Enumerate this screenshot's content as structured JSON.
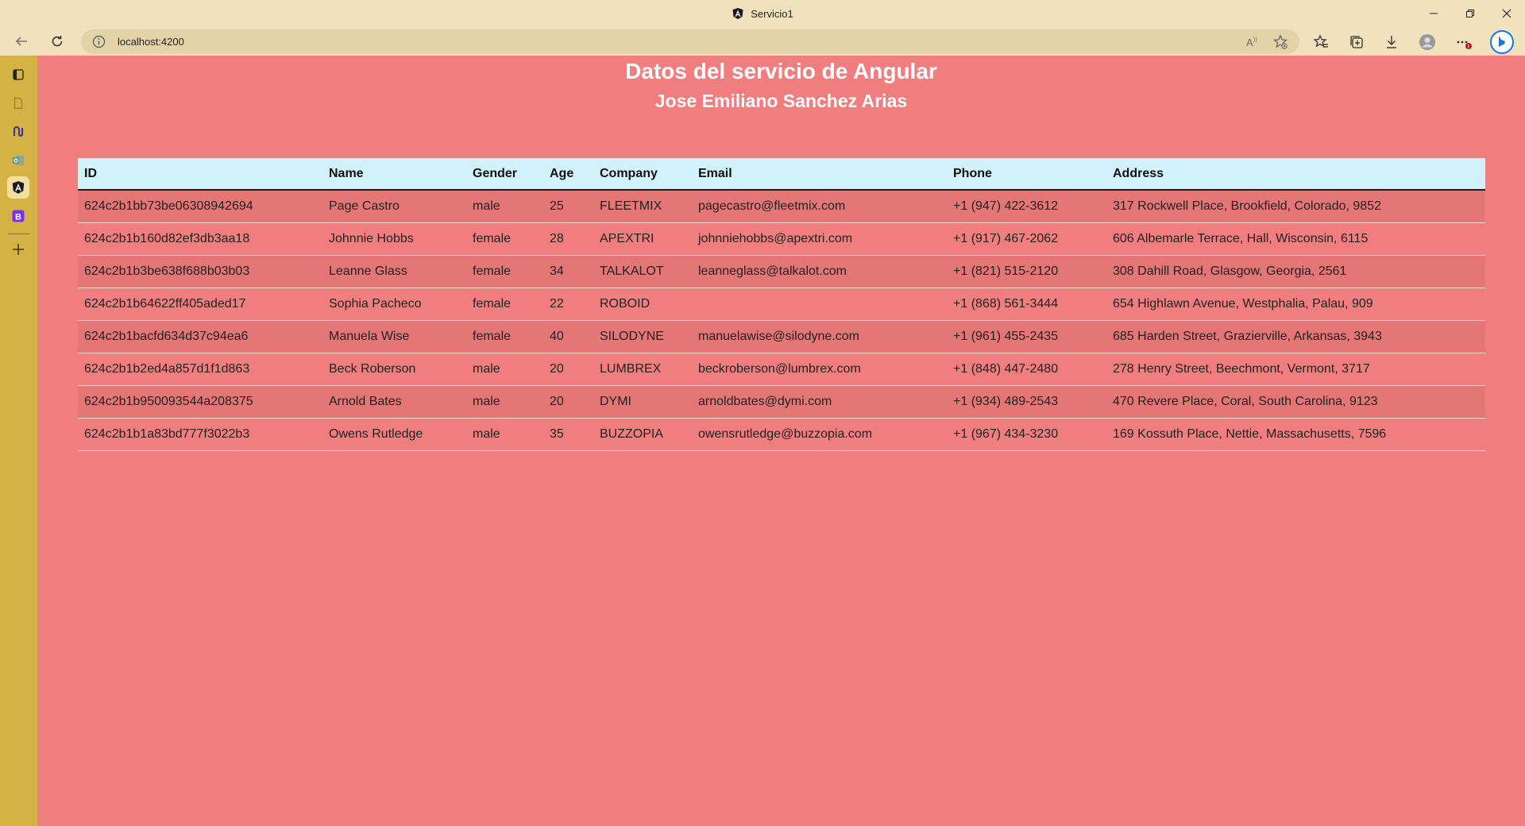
{
  "window": {
    "title": "Servicio1"
  },
  "browser": {
    "url": "localhost:4200"
  },
  "page": {
    "title": "Datos del servicio de Angular",
    "subtitle": "Jose Emiliano Sanchez Arias"
  },
  "table": {
    "headers": {
      "id": "ID",
      "name": "Name",
      "gender": "Gender",
      "age": "Age",
      "company": "Company",
      "email": "Email",
      "phone": "Phone",
      "address": "Address"
    },
    "rows": [
      {
        "id": "624c2b1bb73be06308942694",
        "name": "Page Castro",
        "gender": "male",
        "age": "25",
        "company": "FLEETMIX",
        "email": "pagecastro@fleetmix.com",
        "phone": "+1 (947) 422-3612",
        "address": "317 Rockwell Place, Brookfield, Colorado, 9852"
      },
      {
        "id": "624c2b1b160d82ef3db3aa18",
        "name": "Johnnie Hobbs",
        "gender": "female",
        "age": "28",
        "company": "APEXTRI",
        "email": "johnniehobbs@apextri.com",
        "phone": "+1 (917) 467-2062",
        "address": "606 Albemarle Terrace, Hall, Wisconsin, 6115"
      },
      {
        "id": "624c2b1b3be638f688b03b03",
        "name": "Leanne Glass",
        "gender": "female",
        "age": "34",
        "company": "TALKALOT",
        "email": "leanneglass@talkalot.com",
        "phone": "+1 (821) 515-2120",
        "address": "308 Dahill Road, Glasgow, Georgia, 2561"
      },
      {
        "id": "624c2b1b64622ff405aded17",
        "name": "Sophia Pacheco",
        "gender": "female",
        "age": "22",
        "company": "ROBOID",
        "email": "",
        "phone": "+1 (868) 561-3444",
        "address": "654 Highlawn Avenue, Westphalia, Palau, 909"
      },
      {
        "id": "624c2b1bacfd634d37c94ea6",
        "name": "Manuela Wise",
        "gender": "female",
        "age": "40",
        "company": "SILODYNE",
        "email": "manuelawise@silodyne.com",
        "phone": "+1 (961) 455-2435",
        "address": "685 Harden Street, Grazierville, Arkansas, 3943"
      },
      {
        "id": "624c2b1b2ed4a857d1f1d863",
        "name": "Beck Roberson",
        "gender": "male",
        "age": "20",
        "company": "LUMBREX",
        "email": "beckroberson@lumbrex.com",
        "phone": "+1 (848) 447-2480",
        "address": "278 Henry Street, Beechmont, Vermont, 3717"
      },
      {
        "id": "624c2b1b950093544a208375",
        "name": "Arnold Bates",
        "gender": "male",
        "age": "20",
        "company": "DYMI",
        "email": "arnoldbates@dymi.com",
        "phone": "+1 (934) 489-2543",
        "address": "470 Revere Place, Coral, South Carolina, 9123"
      },
      {
        "id": "624c2b1b1a83bd777f3022b3",
        "name": "Owens Rutledge",
        "gender": "male",
        "age": "35",
        "company": "BUZZOPIA",
        "email": "owensrutledge@buzzopia.com",
        "phone": "+1 (967) 434-3230",
        "address": "169 Kossuth Place, Nettie, Massachusetts, 7596"
      }
    ]
  },
  "sidebar": {
    "items": [
      {
        "icon": "tab-actions-icon"
      },
      {
        "icon": "document-icon"
      },
      {
        "icon": "loop-icon"
      },
      {
        "icon": "outlook-icon"
      },
      {
        "icon": "angular-icon",
        "active": true
      },
      {
        "icon": "bootstrap-icon"
      }
    ]
  },
  "colors": {
    "page_background": "#f07e7e",
    "row_stripe": "#e47676",
    "header_background": "#d1f1fb",
    "browser_chrome": "#efe2bd",
    "sidebar": "#d6b244",
    "title_text": "#ffffff"
  }
}
